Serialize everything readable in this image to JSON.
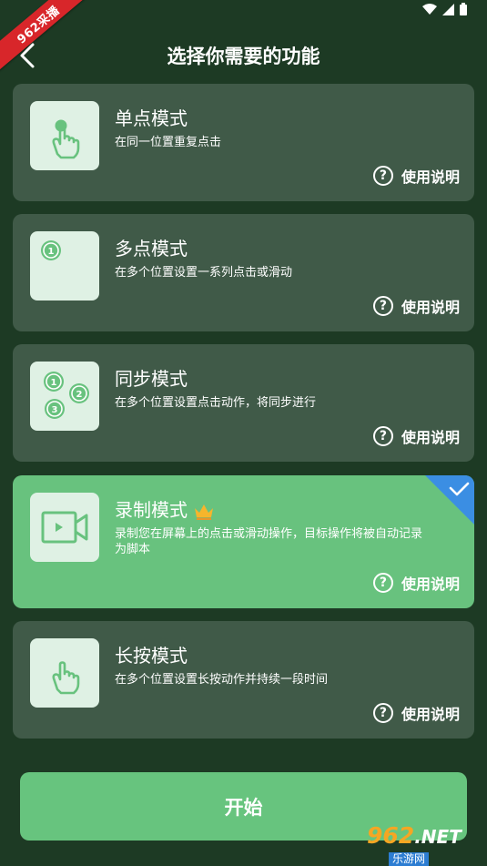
{
  "watermark": {
    "corner_ribbon": "962采播",
    "site_number": "962",
    "site_suffix": ".NET",
    "site_name": "乐游网"
  },
  "header": {
    "title": "选择你需要的功能"
  },
  "help_label": "使用说明",
  "help_glyph": "?",
  "cards": [
    {
      "title": "单点模式",
      "description": "在同一位置重复点击",
      "icon": "tap-finger-icon",
      "selected": false
    },
    {
      "title": "多点模式",
      "description": "在多个位置设置一系列点击或滑动",
      "icon": "multi-point-icon",
      "selected": false,
      "badges": [
        "1"
      ]
    },
    {
      "title": "同步模式",
      "description": "在多个位置设置点击动作，将同步进行",
      "icon": "sync-points-icon",
      "selected": false,
      "badges": [
        "1",
        "2",
        "3"
      ]
    },
    {
      "title": "录制模式",
      "description": "录制您在屏幕上的点击或滑动操作，目标操作将被自动记录为脚本",
      "icon": "video-camera-icon",
      "selected": true,
      "vip": "crown-icon"
    },
    {
      "title": "长按模式",
      "description": "在多个位置设置长按动作并持续一段时间",
      "icon": "long-press-finger-icon",
      "selected": false
    }
  ],
  "start_button": {
    "label": "开始"
  },
  "colors": {
    "background": "#1d3a24",
    "card": "#405a48",
    "selected_card": "#68c27e",
    "accent_green": "#67c47e",
    "icon_tile": "#dff1e4",
    "check_corner": "#3b8ee3"
  }
}
